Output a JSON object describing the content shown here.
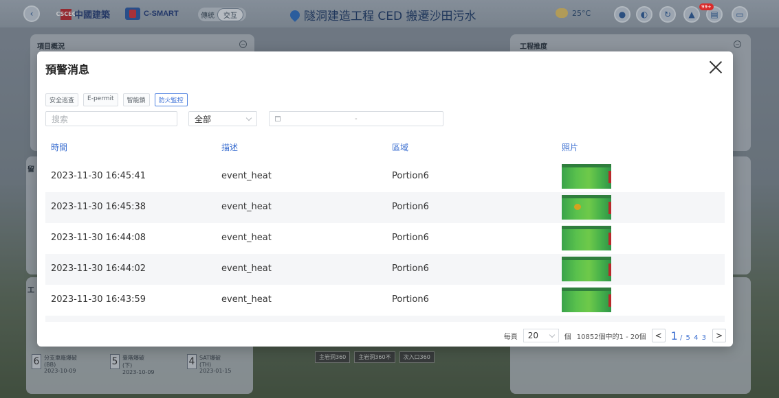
{
  "header": {
    "back_icon": "‹",
    "company": "中國建築",
    "company_en": "CSCEC",
    "app_name": "C-SMART",
    "modes": [
      "傳統",
      "交互"
    ],
    "active_mode": "交互",
    "project_title": "隧洞建造工程 CED 搬遷沙田污水",
    "temperature": "25°C",
    "notification_badge": "99+"
  },
  "background": {
    "panel_project_overview": "項目概況",
    "panel_progress": "工程推度",
    "left_panel2_label": "留",
    "left_panel3_label": "工",
    "bottom_tags": [
      "主岩洞360",
      "主岩洞360不",
      "次入口360"
    ],
    "stats": [
      {
        "num": "6",
        "label": "分支車廠爆破",
        "sub": "(BB)",
        "date": "2023-10-09"
      },
      {
        "num": "5",
        "label": "臺階爆破",
        "sub": "(下)",
        "date": "2023-10-09"
      },
      {
        "num": "4",
        "label": "SAT爆破",
        "sub": "(TH)",
        "date": "2023-01-15"
      }
    ]
  },
  "dialog": {
    "title": "預警消息",
    "tabs": [
      "安全巡查",
      "E-permit",
      "智能鎖",
      "防火監控"
    ],
    "active_tab": "防火監控",
    "search_placeholder": "搜索",
    "filter_value": "全部",
    "date_separator": "-",
    "columns": [
      "時間",
      "描述",
      "區域",
      "照片"
    ],
    "rows": [
      {
        "time": "2023-11-30 16:45:41",
        "desc": "event_heat",
        "area": "Portion6"
      },
      {
        "time": "2023-11-30 16:45:38",
        "desc": "event_heat",
        "area": "Portion6"
      },
      {
        "time": "2023-11-30 16:44:08",
        "desc": "event_heat",
        "area": "Portion6"
      },
      {
        "time": "2023-11-30 16:44:02",
        "desc": "event_heat",
        "area": "Portion6"
      },
      {
        "time": "2023-11-30 16:43:59",
        "desc": "event_heat",
        "area": "Portion6"
      }
    ],
    "pagination": {
      "per_page_label": "每頁",
      "per_page": "20",
      "unit": "個",
      "summary": "10852個中的1 - 20個",
      "current_page": "1",
      "total_pages": "/ 5 4 3",
      "prev": "<",
      "next": ">"
    }
  }
}
